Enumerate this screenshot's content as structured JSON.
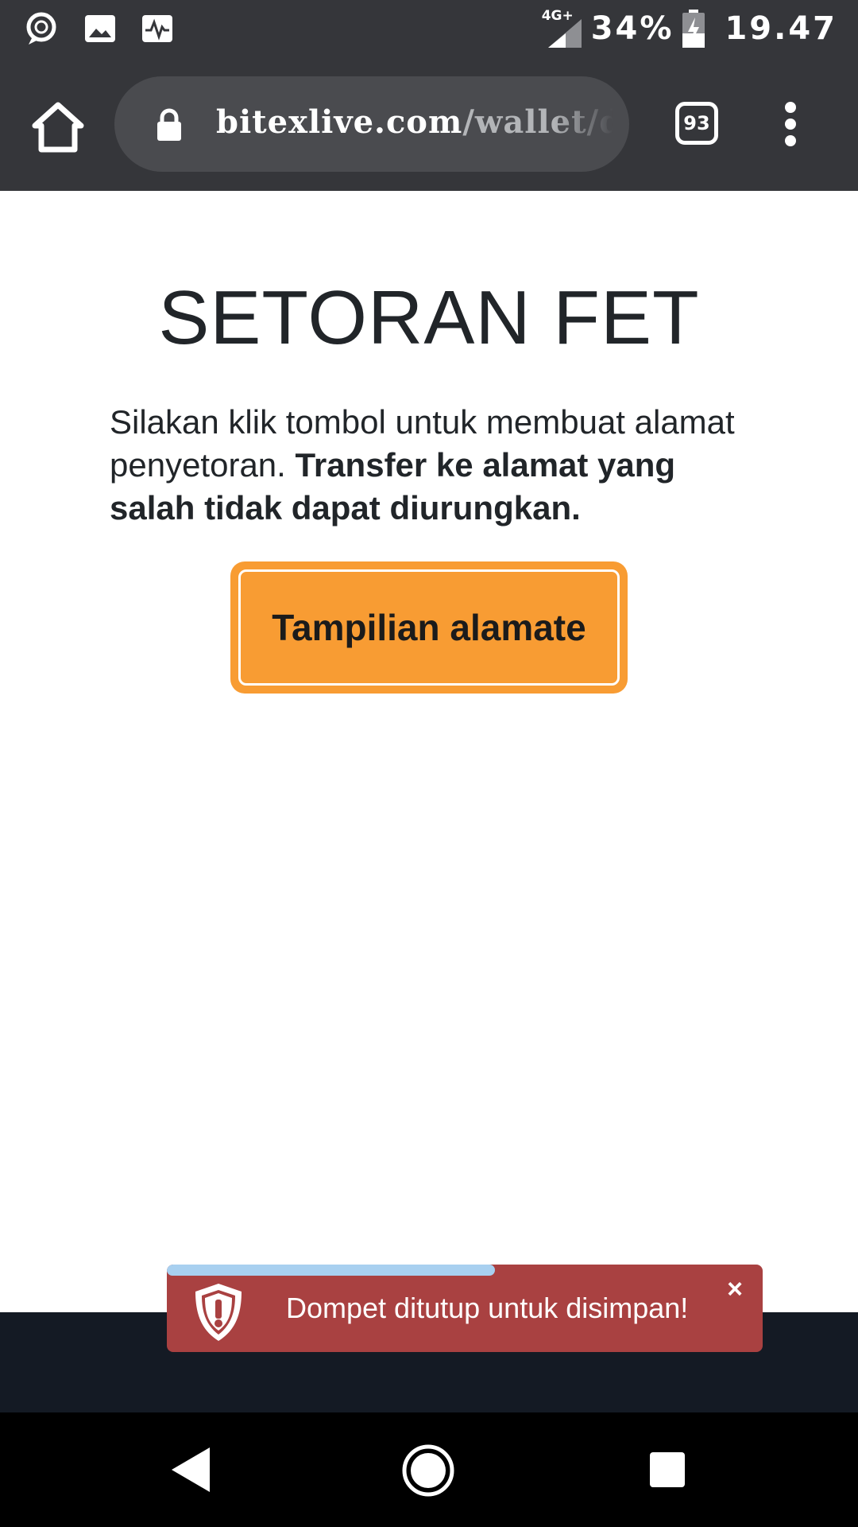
{
  "statusbar": {
    "network": "4G+",
    "battery_percent": "34%",
    "time": "19.47",
    "icons": [
      "chat-notification-icon",
      "gallery-notification-icon",
      "activity-notification-icon",
      "signal-icon",
      "battery-charging-icon"
    ]
  },
  "browser": {
    "url_host": "bitexlive.com",
    "url_path": "/wallet/de",
    "tab_count": "93"
  },
  "main": {
    "title": "SETORAN FET",
    "desc_normal": "Silakan klik tombol untuk membuat alamat penyetoran. ",
    "desc_bold": "Transfer ke alamat yang salah tidak dapat diurungkan.",
    "button_label": "Tampilian alamate"
  },
  "toast": {
    "message": "Dompet ditutup untuk disimpan!",
    "close_label": "×",
    "progress": 0.55,
    "color": "#a94141"
  },
  "colors": {
    "toolbar": "#35363a",
    "accent_button": "#f89c33",
    "toast_progress": "#a8d0f0",
    "footer": "#141a24"
  }
}
